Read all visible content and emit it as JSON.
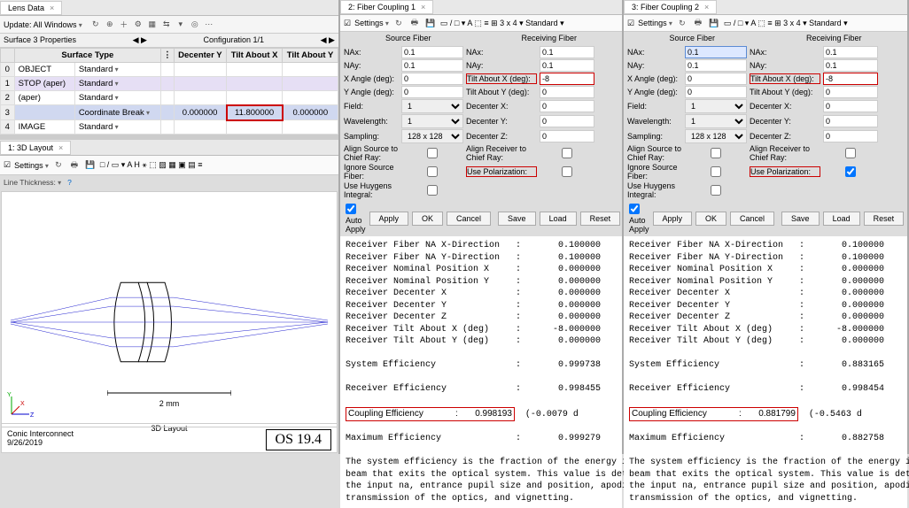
{
  "lens": {
    "title": "Lens Data",
    "update_label": "Update: All Windows",
    "subbar_left": "Surface 3 Properties",
    "subbar_right": "Configuration 1/1",
    "cols": [
      "",
      "Surface Type",
      "⋮",
      "Decenter Y",
      "Tilt About X",
      "Tilt About Y"
    ],
    "rows": [
      {
        "n": "0",
        "name": "OBJECT",
        "type": "Standard",
        "dy": "",
        "tx": "",
        "ty": ""
      },
      {
        "n": "1",
        "name": "STOP (aper)",
        "type": "Standard",
        "dy": "",
        "tx": "",
        "ty": ""
      },
      {
        "n": "2",
        "name": "(aper)",
        "type": "Standard",
        "dy": "",
        "tx": "",
        "ty": ""
      },
      {
        "n": "3",
        "name": "",
        "type": "Coordinate Break",
        "dy": "0.000000",
        "tx": "11.800000",
        "ty": "0.000000"
      },
      {
        "n": "4",
        "name": "IMAGE",
        "type": "Standard",
        "dy": "",
        "tx": "",
        "ty": ""
      }
    ]
  },
  "layout": {
    "title": "1: 3D Layout",
    "settings": "Settings",
    "linethick": "Line Thickness:",
    "caption": "3D Layout",
    "scale": "2 mm",
    "footer_left": "Conic Interconnect",
    "footer_date": "9/26/2019",
    "os": "OS 19.4"
  },
  "panels": [
    {
      "title": "2: Fiber Coupling 1",
      "tilt_x_val": "-8",
      "use_polar_checked": false,
      "nax_src": "0.1",
      "results": {
        "sys_eff": "0.999738",
        "rec_eff": "0.998455",
        "coup_eff": "0.998193",
        "coup_extra": "(-0.0079 d",
        "max_eff": "0.999279"
      }
    },
    {
      "title": "3: Fiber Coupling 2",
      "tilt_x_val": "-8",
      "use_polar_checked": true,
      "nax_src": "0.1",
      "results": {
        "sys_eff": "0.883165",
        "rec_eff": "0.998454",
        "coup_eff": "0.881799",
        "coup_extra": "(-0.5463 d",
        "max_eff": "0.882758"
      }
    }
  ],
  "fiber_common": {
    "src_h": "Source Fiber",
    "recv_h": "Receiving Fiber",
    "nax": "NAx:",
    "nay": "NAy:",
    "xang": "X Angle (deg):",
    "yang": "Y Angle (deg):",
    "field": "Field:",
    "wave": "Wavelength:",
    "samp": "Sampling:",
    "tiltx": "Tilt About X (deg):",
    "tilty": "Tilt About Y (deg):",
    "decx": "Decenter X:",
    "decy": "Decenter Y:",
    "decz": "Decenter Z:",
    "align_src": "Align Source to Chief Ray:",
    "align_rcv": "Align Receiver to Chief Ray:",
    "ignore": "Ignore Source Fiber:",
    "usepol": "Use Polarization:",
    "huygens": "Use Huygens Integral:",
    "vals": {
      "na": "0.1",
      "ang": "0",
      "field": "1",
      "wave": "1",
      "samp": "128 x 128",
      "dec": "0"
    },
    "auto": "Auto Apply",
    "apply": "Apply",
    "ok": "OK",
    "cancel": "Cancel",
    "save": "Save",
    "load": "Load",
    "reset": "Reset"
  },
  "report": {
    "rx_na_x": "Receiver Fiber NA X-Direction   :       0.100000",
    "rx_na_y": "Receiver Fiber NA Y-Direction   :       0.100000",
    "rx_nom_x": "Receiver Nominal Position X     :       0.000000",
    "rx_nom_y": "Receiver Nominal Position Y     :       0.000000",
    "rx_dec_x": "Receiver Decenter X             :       0.000000",
    "rx_dec_y": "Receiver Decenter Y             :       0.000000",
    "rx_dec_z": "Receiver Decenter Z             :       0.000000",
    "rx_tx": "Receiver Tilt About X (deg)     :      -8.000000",
    "rx_ty": "Receiver Tilt About Y (deg)     :       0.000000",
    "sys": "System Efficiency               :       ",
    "rec": "Receiver Efficiency             :       ",
    "coup": "Coupling Efficiency             :       ",
    "max": "Maximum Efficiency              :       ",
    "blurb": "The system efficiency is the fraction of the energy in the sour\nbeam that exits the optical system. This value is determined by\nthe input na, entrance pupil size and position, apodization,\ntransmission of the optics, and vignetting."
  }
}
